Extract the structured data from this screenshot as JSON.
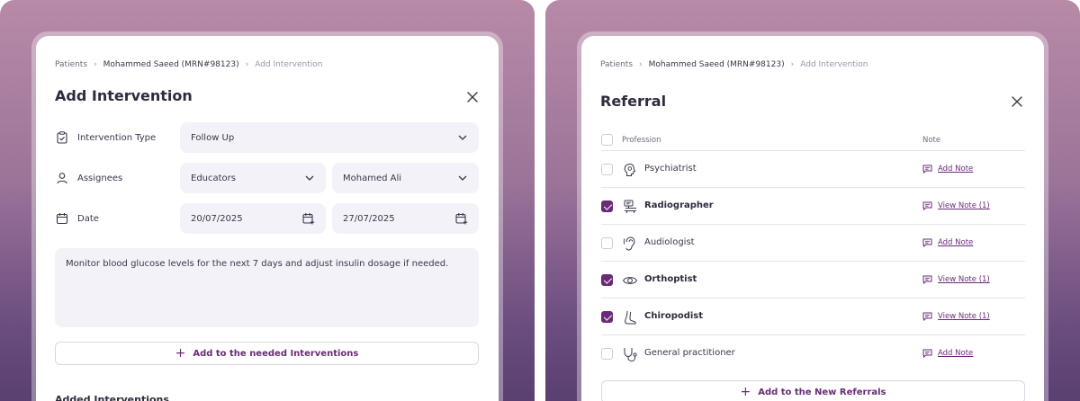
{
  "left": {
    "breadcrumb": [
      "Patients",
      "Mohammed Saeed (MRN#98123)",
      "Add Intervention"
    ],
    "title": "Add Intervention",
    "fields": {
      "intervention_type_label": "Intervention Type",
      "intervention_type_value": "Follow Up",
      "assignees_label": "Assignees",
      "assignee_group": "Educators",
      "assignee_person": "Mohamed Ali",
      "date_label": "Date",
      "date_start": "20/07/2025",
      "date_end": "27/07/2025"
    },
    "note_text": "Monitor blood glucose levels for the next 7 days and adjust insulin dosage if needed.",
    "add_button": "Add to the needed Interventions",
    "added_heading": "Added Interventions"
  },
  "right": {
    "breadcrumb": [
      "Patients",
      "Mohammed Saeed (MRN#98123)",
      "Add Intervention"
    ],
    "title": "Referral",
    "columns": {
      "profession": "Profession",
      "note": "Note"
    },
    "rows": [
      {
        "name": "Psychiatrist",
        "checked": false,
        "note": "Add Note",
        "icon": "brain-icon"
      },
      {
        "name": "Radiographer",
        "checked": true,
        "note": "View Note (1)",
        "icon": "xray-machine-icon"
      },
      {
        "name": "Audiologist",
        "checked": false,
        "note": "Add Note",
        "icon": "ear-icon"
      },
      {
        "name": "Orthoptist",
        "checked": true,
        "note": "View Note (1)",
        "icon": "eye-icon"
      },
      {
        "name": "Chiropodist",
        "checked": true,
        "note": "View Note (1)",
        "icon": "foot-icon"
      },
      {
        "name": "General practitioner",
        "checked": false,
        "note": "Add Note",
        "icon": "stethoscope-icon"
      }
    ],
    "add_button": "Add to the New Referrals"
  },
  "colors": {
    "accent": "#6a2a78",
    "field_bg": "#f4f2f9",
    "text": "#3a3648"
  }
}
